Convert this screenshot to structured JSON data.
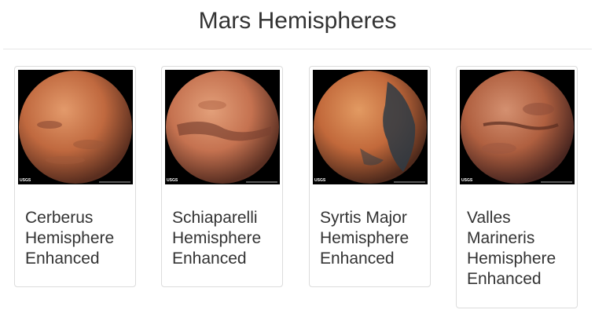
{
  "header": {
    "title": "Mars Hemispheres"
  },
  "hemispheres": [
    {
      "lines": [
        "Cerberus",
        "Hemisphere",
        "Enhanced"
      ],
      "image_icon": "mars-globe-icon",
      "badge": "USGS"
    },
    {
      "lines": [
        "Schiaparelli",
        "Hemisphere",
        "Enhanced"
      ],
      "image_icon": "mars-globe-icon",
      "badge": "USGS"
    },
    {
      "lines": [
        "Syrtis Major",
        "Hemisphere",
        "Enhanced"
      ],
      "image_icon": "mars-globe-icon",
      "badge": "USGS"
    },
    {
      "lines": [
        "Valles",
        "Marineris",
        "Hemisphere",
        "Enhanced"
      ],
      "image_icon": "mars-globe-icon",
      "badge": "USGS"
    }
  ],
  "colors": {
    "mars_light": "#d98a5c",
    "mars_mid": "#b5603a",
    "mars_dark": "#6e3a26",
    "mars_shadow": "#3a2a2a",
    "syrtis_dark": "#2f3b44"
  }
}
